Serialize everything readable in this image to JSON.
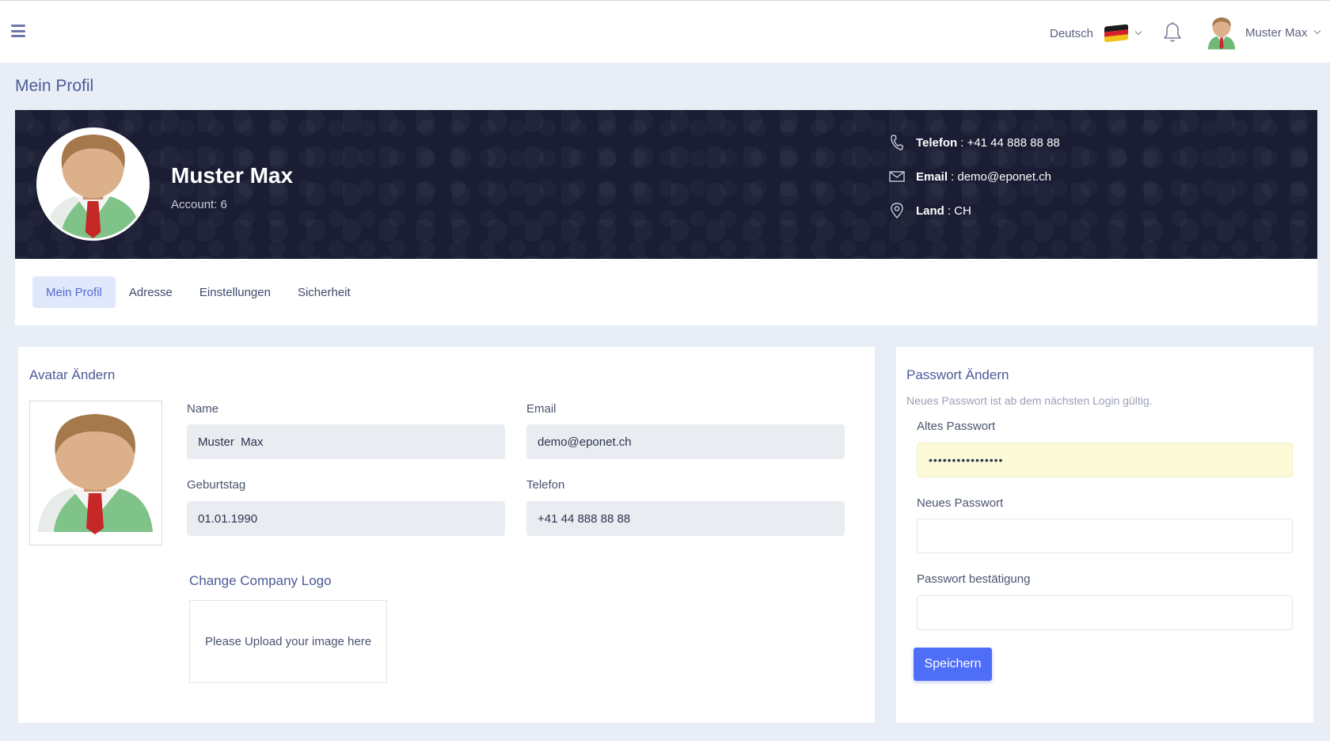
{
  "topbar": {
    "language_label": "Deutsch",
    "user_name": "Muster Max"
  },
  "page": {
    "title": "Mein Profil"
  },
  "profile": {
    "name": "Muster Max",
    "account": "Account: 6",
    "contact": {
      "phone_label": "Telefon",
      "phone_value": ": +41 44 888 88 88",
      "email_label": "Email",
      "email_value": ": demo@eponet.ch",
      "country_label": "Land",
      "country_value": ": CH"
    }
  },
  "tabs": [
    {
      "label": "Mein Profil",
      "active": true
    },
    {
      "label": "Adresse",
      "active": false
    },
    {
      "label": "Einstellungen",
      "active": false
    },
    {
      "label": "Sicherheit",
      "active": false
    }
  ],
  "avatar_card": {
    "title": "Avatar Ändern",
    "fields": {
      "name_label": "Name",
      "name_value": "Muster  Max",
      "email_label": "Email",
      "email_value": "demo@eponet.ch",
      "birthday_label": "Geburtstag",
      "birthday_value": "01.01.1990",
      "phone_label": "Telefon",
      "phone_value": "+41 44 888 88 88"
    },
    "logo_title": "Change Company Logo",
    "upload_text": "Please Upload your image here"
  },
  "password_card": {
    "title": "Passwort Ändern",
    "subtitle": "Neues Passwort ist ab dem nächsten Login gültig.",
    "old_label": "Altes Passwort",
    "old_value": "••••••••••••••••",
    "new_label": "Neues Passwort",
    "new_value": "",
    "confirm_label": "Passwort bestätigung",
    "confirm_value": "",
    "save_label": "Speichern"
  },
  "colors": {
    "accent": "#4f6ef7",
    "banner": "#1a1d33",
    "page_bg": "#e9eef6",
    "tab_active_bg": "#e0e8fb"
  }
}
